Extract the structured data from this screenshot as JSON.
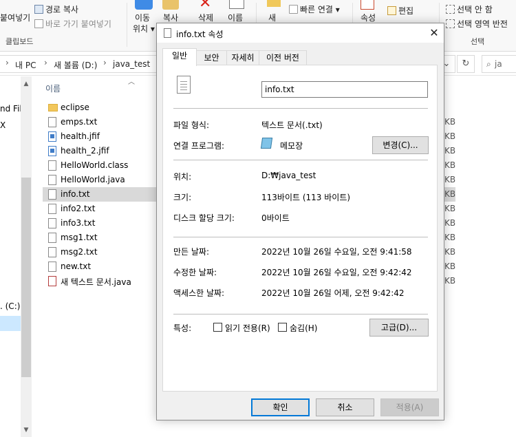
{
  "ribbon": {
    "paste_label": "붙여넣기",
    "copy_path": "경로 복사",
    "paste_shortcut": "바로 가기 붙여넣기",
    "clipboard_group": "클립보드",
    "move_to": "이동",
    "move_to_sub": "위치",
    "copy_to": "복사",
    "delete": "삭제",
    "rename": "이름",
    "new_folder": "새",
    "easy_access": "빠른 연결",
    "properties": "속성",
    "edit": "편집",
    "select_none": "선택 안 함",
    "invert_selection": "선택 영역 반전",
    "select_group": "선택"
  },
  "address": {
    "crumbs": [
      "내 PC",
      "새 볼륨 (D:)",
      "java_test"
    ],
    "search_placeholder": "ja"
  },
  "nav": {
    "item_1": "nd File",
    "item_2": "X",
    "item_3": ". (C:)"
  },
  "filelist": {
    "column_name": "이름",
    "files": [
      {
        "name": "eclipse",
        "icon": "folder-icon",
        "size": ""
      },
      {
        "name": "emps.txt",
        "icon": "text-file-icon",
        "size": "KB"
      },
      {
        "name": "health.jfif",
        "icon": "image-file-icon",
        "size": "KB"
      },
      {
        "name": "health_2.jfif",
        "icon": "image-file-icon",
        "size": "KB"
      },
      {
        "name": "HelloWorld.class",
        "icon": "blank-file-icon",
        "size": "KB"
      },
      {
        "name": "HelloWorld.java",
        "icon": "text-file-icon",
        "size": "KB"
      },
      {
        "name": "info.txt",
        "icon": "text-file-icon",
        "size": "KB"
      },
      {
        "name": "info2.txt",
        "icon": "text-file-icon",
        "size": "KB"
      },
      {
        "name": "info3.txt",
        "icon": "text-file-icon",
        "size": "KB"
      },
      {
        "name": "msg1.txt",
        "icon": "text-file-icon",
        "size": "KB"
      },
      {
        "name": "msg2.txt",
        "icon": "text-file-icon",
        "size": "KB"
      },
      {
        "name": "new.txt",
        "icon": "text-file-icon",
        "size": "KB"
      },
      {
        "name": "새 텍스트 문서.java",
        "icon": "java-file-icon",
        "size": "KB"
      }
    ]
  },
  "dialog": {
    "title": "info.txt 속성",
    "tabs": [
      "일반",
      "보안",
      "자세히",
      "이전 버전"
    ],
    "file_name": "info.txt",
    "file_type_label": "파일 형식:",
    "file_type_value": "텍스트 문서(.txt)",
    "opens_with_label": "연결 프로그램:",
    "opens_with_value": "메모장",
    "change_button": "변경(C)...",
    "location_label": "위치:",
    "location_value": "D:₩java_test",
    "size_label": "크기:",
    "size_value": "113바이트 (113 바이트)",
    "size_on_disk_label": "디스크 할당 크기:",
    "size_on_disk_value": "0바이트",
    "created_label": "만든 날짜:",
    "created_value": "2022년 10월 26일 수요일, 오전 9:41:58",
    "modified_label": "수정한 날짜:",
    "modified_value": "2022년 10월 26일 수요일, 오전 9:42:42",
    "accessed_label": "액세스한 날짜:",
    "accessed_value": "2022년 10월 26일 어제, 오전 9:42:42",
    "attributes_label": "특성:",
    "readonly_label": "읽기 전용(R)",
    "hidden_label": "숨김(H)",
    "advanced_button": "고급(D)...",
    "ok_button": "확인",
    "cancel_button": "취소",
    "apply_button": "적용(A)",
    "accent_color": "#0078d7"
  }
}
